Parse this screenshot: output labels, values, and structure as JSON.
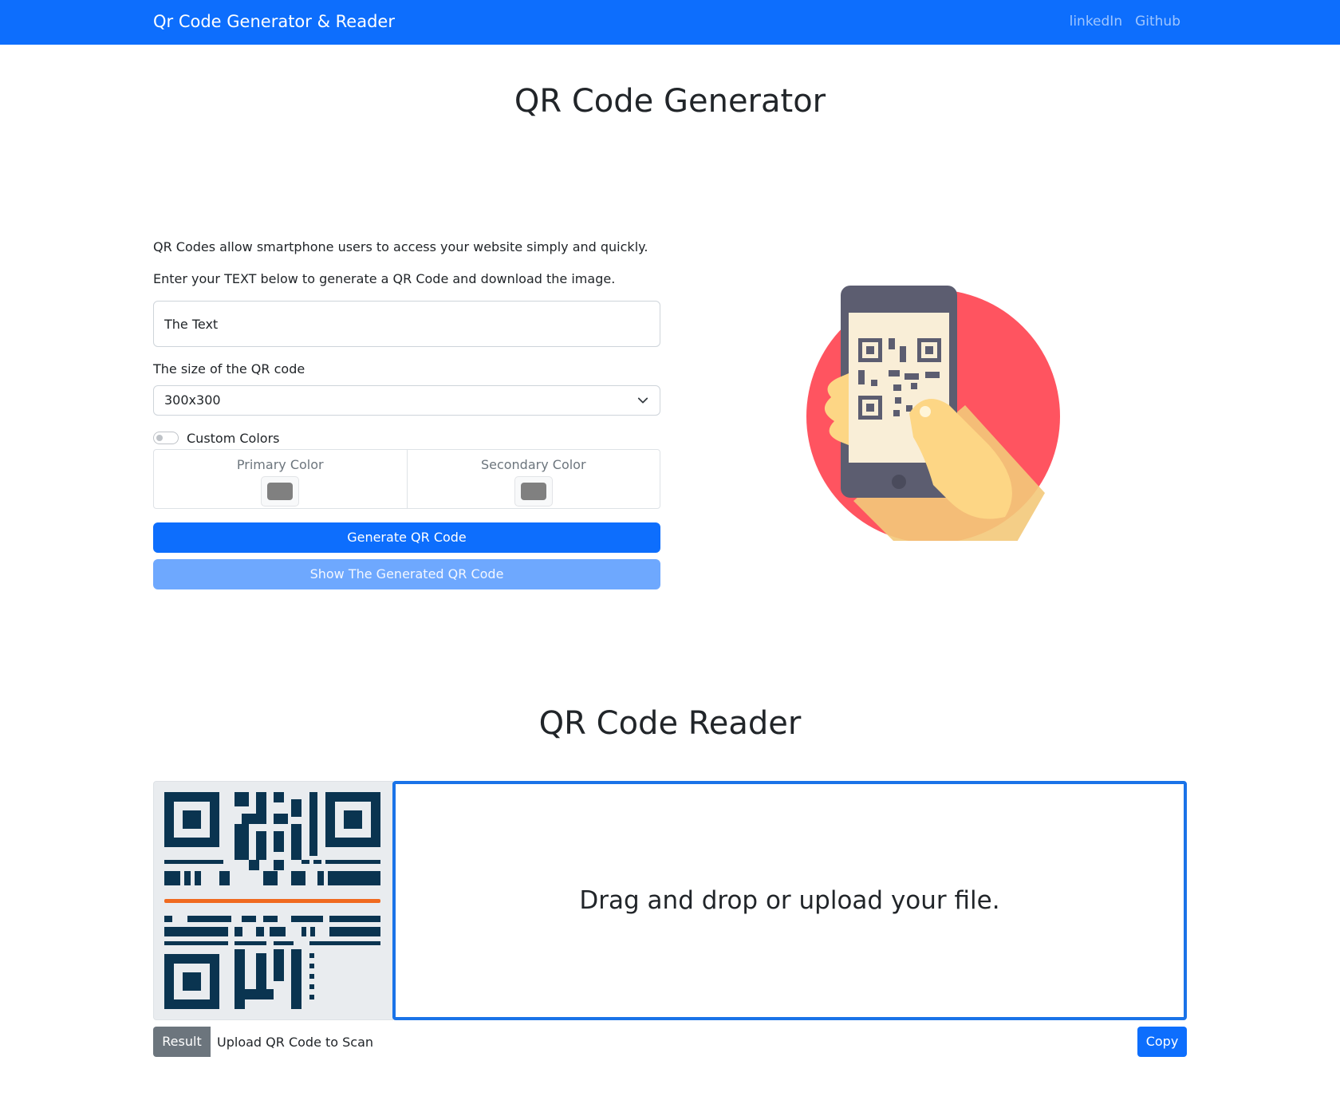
{
  "navbar": {
    "brand": "Qr Code Generator & Reader",
    "links": [
      "linkedIn",
      "Github"
    ]
  },
  "generator": {
    "title": "QR Code Generator",
    "intro_1": "QR Codes allow smartphone users to access your website simply and quickly.",
    "intro_2": "Enter your TEXT below to generate a QR Code and download the image.",
    "text_input_value": "The Text",
    "size_label": "The size of the QR code",
    "size_selected": "300x300",
    "custom_colors_label": "Custom Colors",
    "custom_colors_enabled": false,
    "primary_color_label": "Primary Color",
    "secondary_color_label": "Secondary Color",
    "primary_color": "#808080",
    "secondary_color": "#808080",
    "generate_button": "Generate QR Code",
    "show_button": "Show The Generated QR Code"
  },
  "reader": {
    "title": "QR Code Reader",
    "drop_text": "Drag and drop or upload your file.",
    "result_label": "Result",
    "result_text": "Upload QR Code to Scan",
    "copy_button": "Copy"
  },
  "colors": {
    "primary": "#0d6efd",
    "primary_light": "#6ea8fe",
    "drop_border": "#1a73e8",
    "qr_dark": "#0a3450",
    "scan_line": "#f06a1f",
    "hero_circle": "#ff5460",
    "phone": "#5c5d70",
    "screen": "#f9eed7",
    "hand": "#fdd685"
  },
  "icons": {
    "chevron": "chevron-down-icon",
    "hero": "phone-scanning-qr-illustration",
    "reader_qr": "qr-code-scanner-icon"
  }
}
